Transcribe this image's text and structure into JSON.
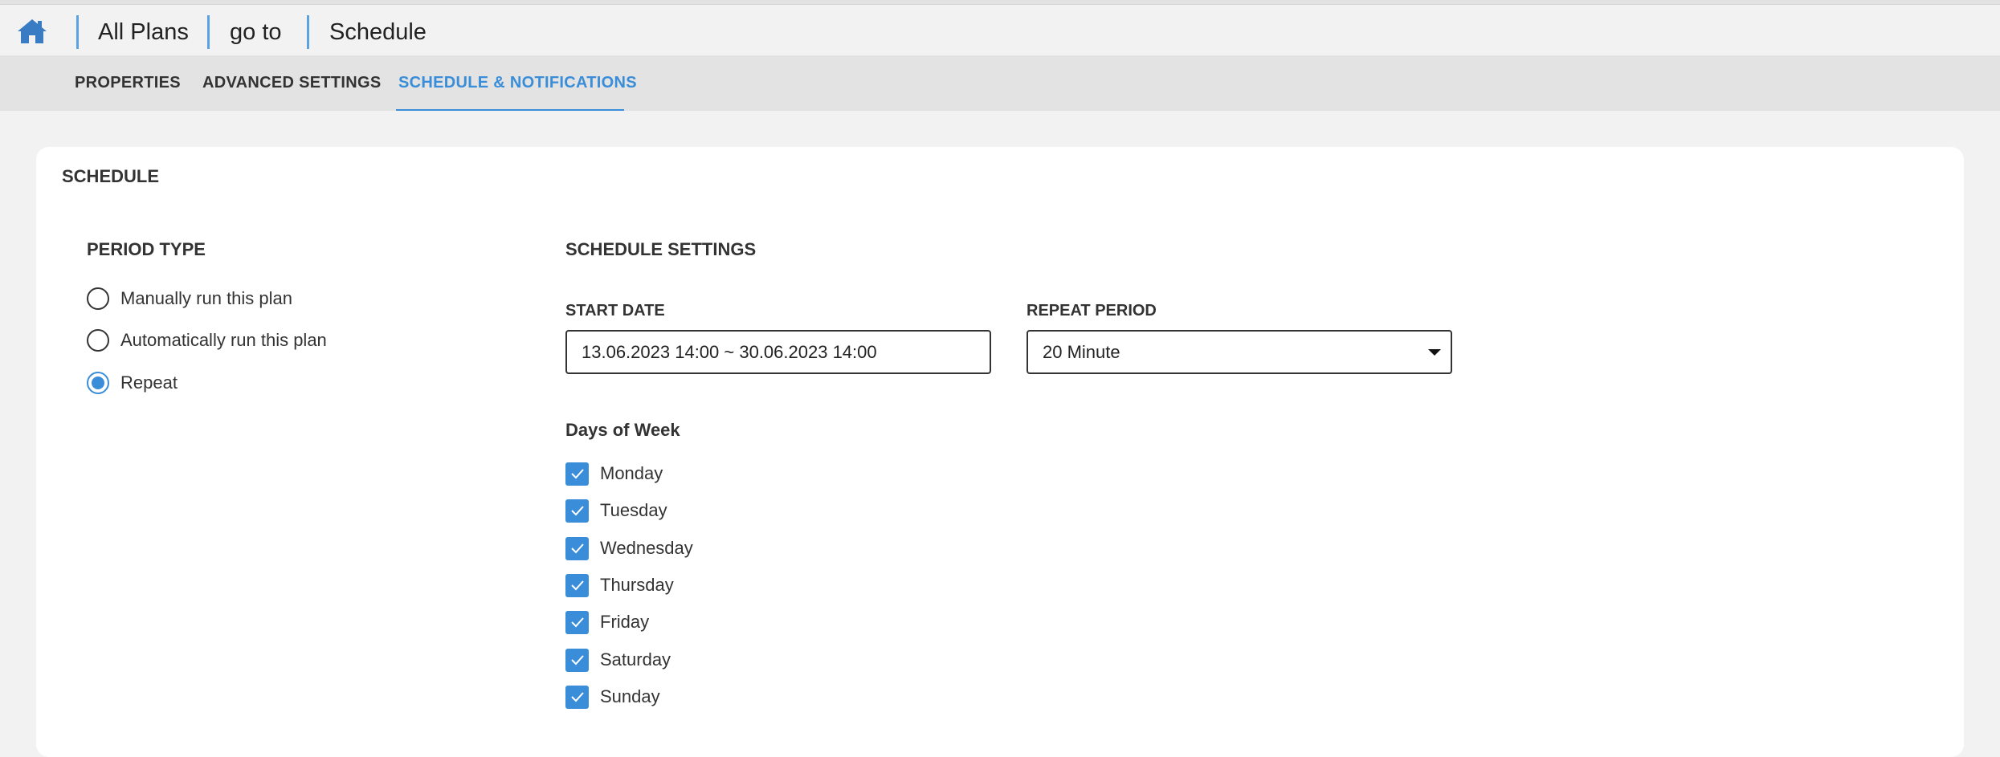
{
  "breadcrumb": {
    "items": [
      "All Plans",
      "go to",
      "Schedule"
    ]
  },
  "tabs": [
    {
      "label": "PROPERTIES",
      "active": false
    },
    {
      "label": "ADVANCED SETTINGS",
      "active": false
    },
    {
      "label": "SCHEDULE & NOTIFICATIONS",
      "active": true
    }
  ],
  "schedule": {
    "title": "SCHEDULE",
    "period_type": {
      "title": "PERIOD TYPE",
      "options": [
        {
          "label": "Manually run this plan",
          "checked": false
        },
        {
          "label": "Automatically run this plan",
          "checked": false
        },
        {
          "label": "Repeat",
          "checked": true
        }
      ]
    },
    "settings": {
      "title": "SCHEDULE SETTINGS",
      "start_date_label": "START DATE",
      "start_date_value": "13.06.2023 14:00 ~ 30.06.2023 14:00",
      "repeat_period_label": "REPEAT PERIOD",
      "repeat_period_value": "20 Minute",
      "days_title": "Days of Week",
      "days": [
        {
          "label": "Monday",
          "checked": true
        },
        {
          "label": "Tuesday",
          "checked": true
        },
        {
          "label": "Wednesday",
          "checked": true
        },
        {
          "label": "Thursday",
          "checked": true
        },
        {
          "label": "Friday",
          "checked": true
        },
        {
          "label": "Saturday",
          "checked": true
        },
        {
          "label": "Sunday",
          "checked": true
        }
      ]
    }
  },
  "colors": {
    "accent": "#3a8dd8",
    "background": "#f2f2f2",
    "tabbar": "#e3e3e3",
    "card": "#ffffff"
  }
}
